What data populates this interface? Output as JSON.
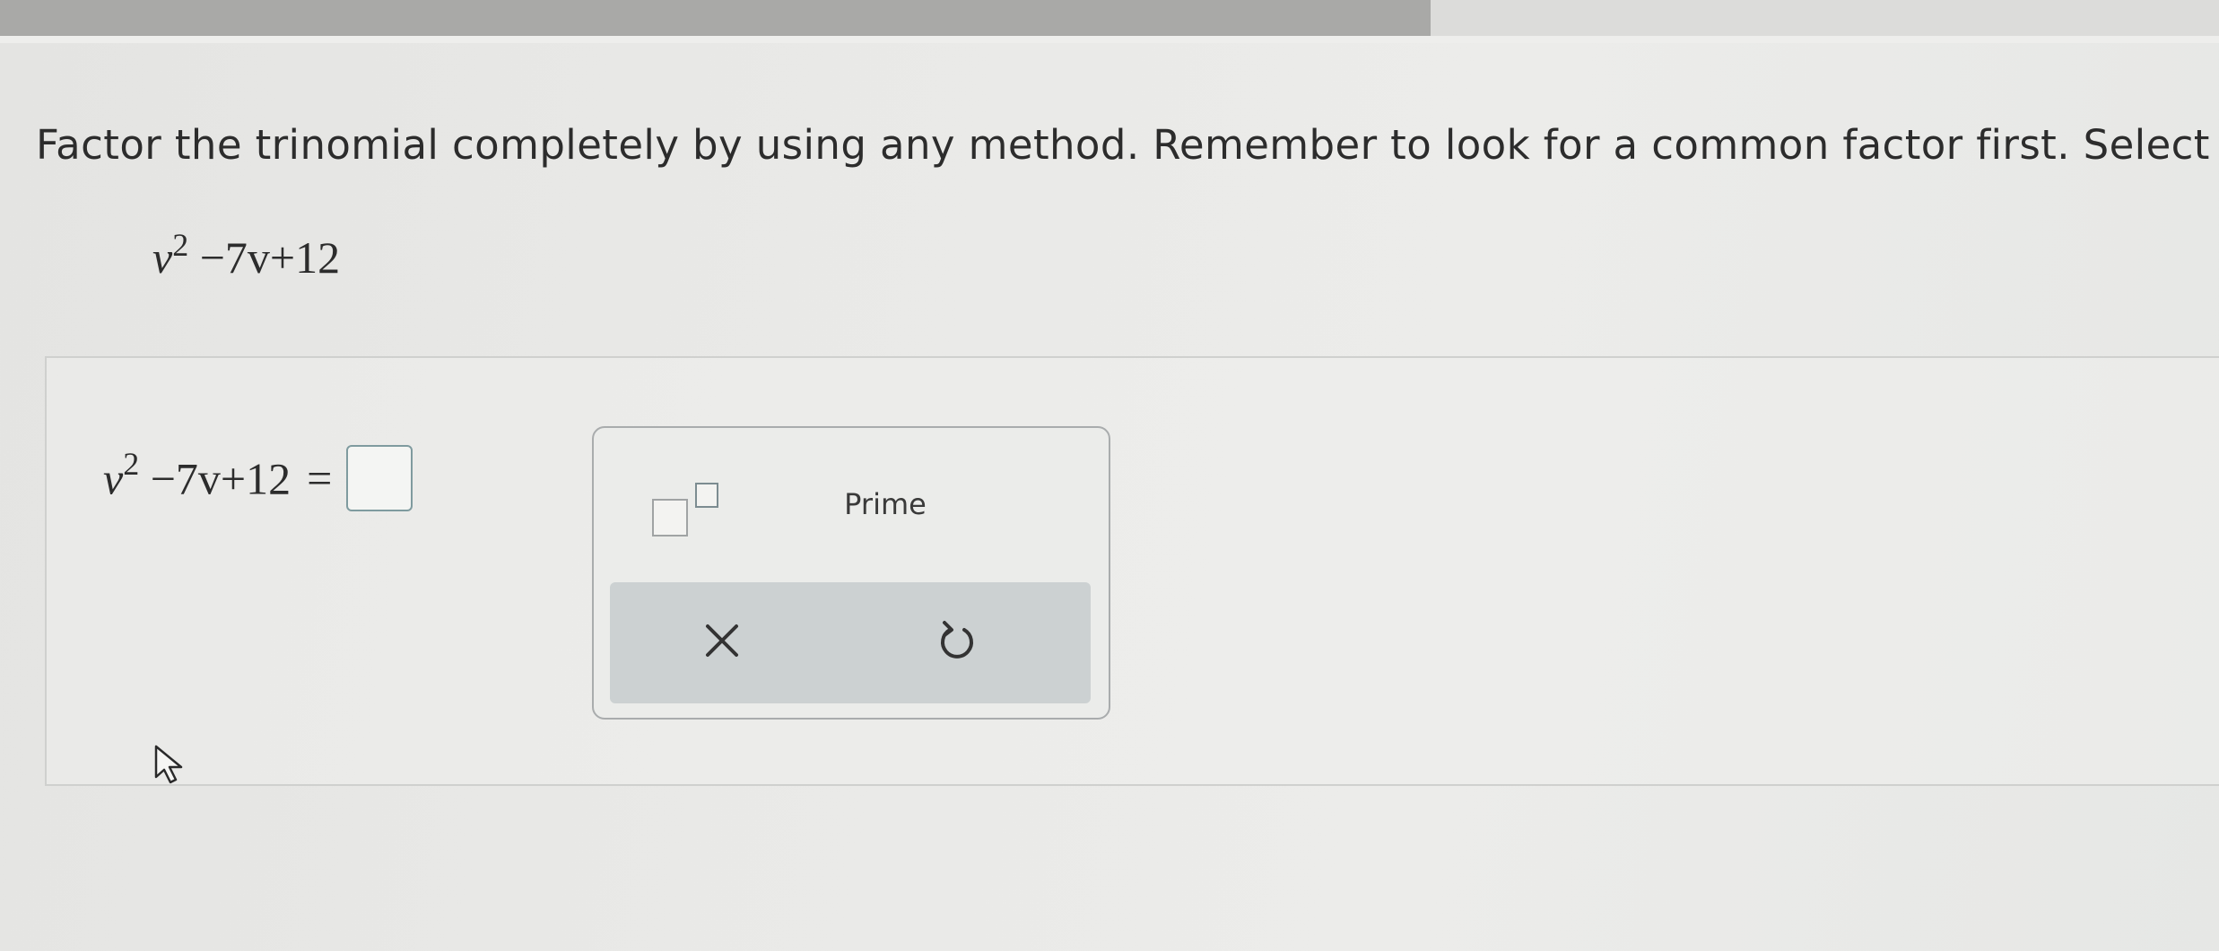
{
  "instruction": {
    "text": "Factor the trinomial completely by using any method. Remember to look for a common factor first. Select \"P"
  },
  "problem": {
    "variable": "v",
    "exponent": "2",
    "rest": "−7v+12"
  },
  "answer": {
    "variable": "v",
    "exponent": "2",
    "rest": "−7v+12",
    "equals": "="
  },
  "keypad": {
    "exponent_tool": "exponent-template",
    "prime_label": "Prime",
    "clear_icon": "close-icon",
    "undo_icon": "undo-icon"
  },
  "colors": {
    "answer_box_border": "#7f9b9f",
    "action_bar": "#ccd1d2"
  }
}
